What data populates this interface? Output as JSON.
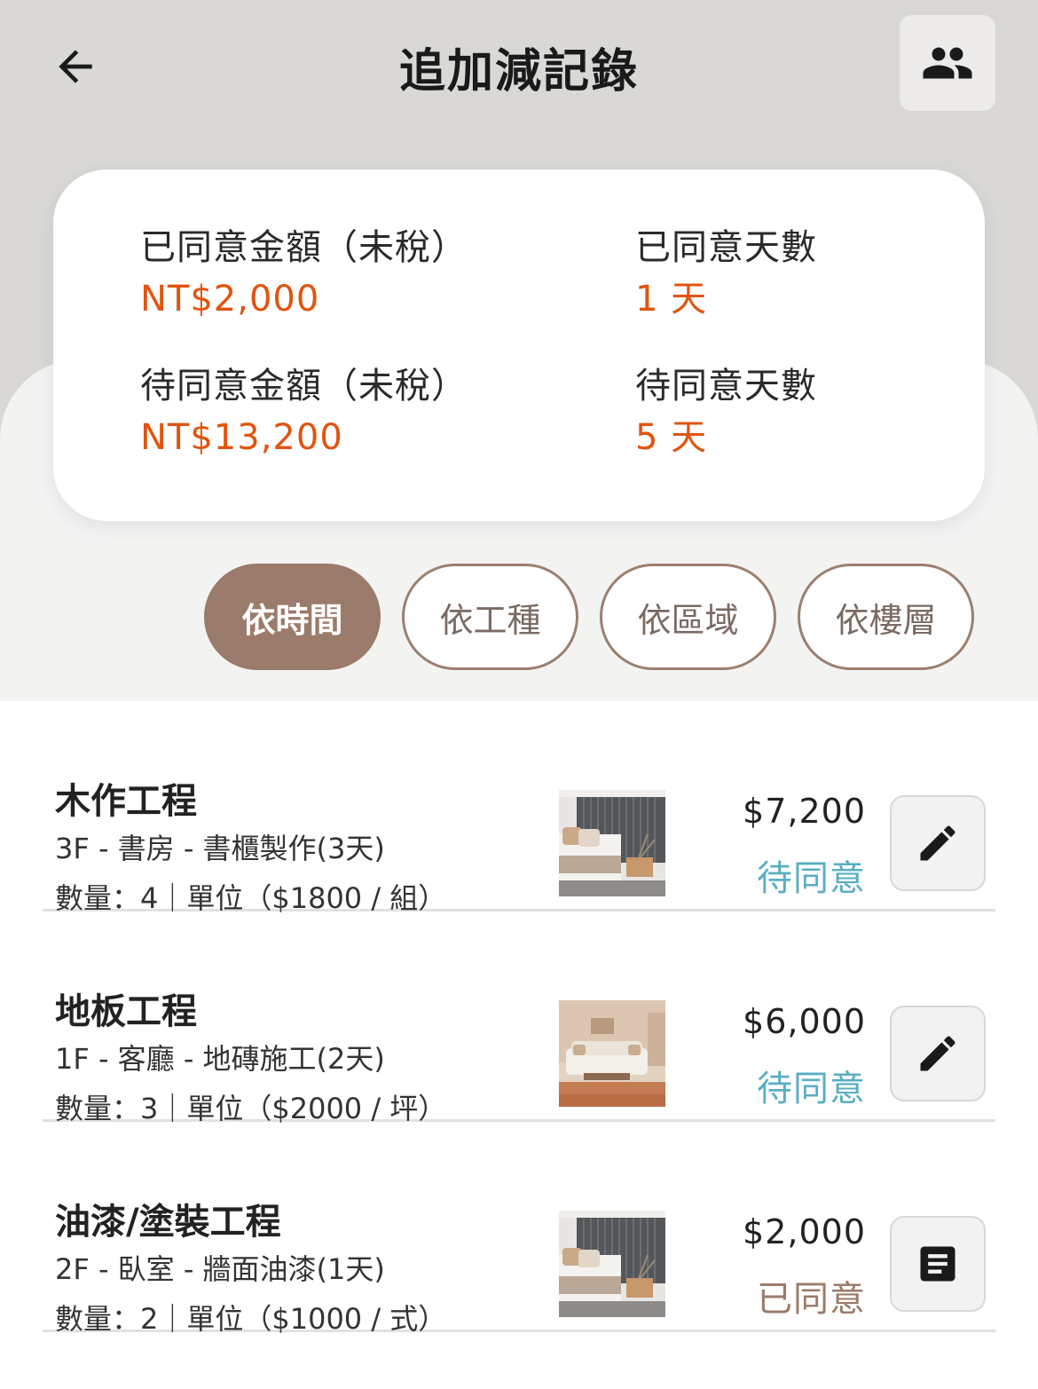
{
  "header": {
    "title": "追加減記錄",
    "back_icon": "arrow-left-icon",
    "team_icon": "people-icon"
  },
  "summary": {
    "agreed_amount_label": "已同意金額（未稅）",
    "agreed_amount_value": "NT$2,000",
    "agreed_days_label": "已同意天數",
    "agreed_days_value": "1 天",
    "pending_amount_label": "待同意金額（未稅）",
    "pending_amount_value": "NT$13,200",
    "pending_days_label": "待同意天數",
    "pending_days_value": "5 天",
    "value_color": "#e2540f"
  },
  "filters": [
    {
      "label": "依時間",
      "active": true
    },
    {
      "label": "依工種",
      "active": false
    },
    {
      "label": "依區域",
      "active": false
    },
    {
      "label": "依樓層",
      "active": false
    }
  ],
  "records": [
    {
      "title": "木作工程",
      "subtitle": "3F - 書房 - 書櫃製作(3天)",
      "quantity": "數量：4｜單位（$1800 / 組）",
      "price": "$7,200",
      "status": "待同意",
      "status_color": "#5aaec4",
      "thumbnail": "bedroom-photo",
      "action_icon": "pencil-icon"
    },
    {
      "title": "地板工程",
      "subtitle": "1F - 客廳 - 地磚施工(2天)",
      "quantity": "數量：3｜單位（$2000 / 坪）",
      "price": "$6,000",
      "status": "待同意",
      "status_color": "#5aaec4",
      "thumbnail": "living-room-photo",
      "action_icon": "pencil-icon"
    },
    {
      "title": "油漆/塗裝工程",
      "subtitle": "2F - 臥室 - 牆面油漆(1天)",
      "quantity": "數量：2｜單位（$1000 / 式）",
      "price": "$2,000",
      "status": "已同意",
      "status_color": "#9b7b6b",
      "thumbnail": "bedroom-photo",
      "action_icon": "document-icon"
    }
  ]
}
